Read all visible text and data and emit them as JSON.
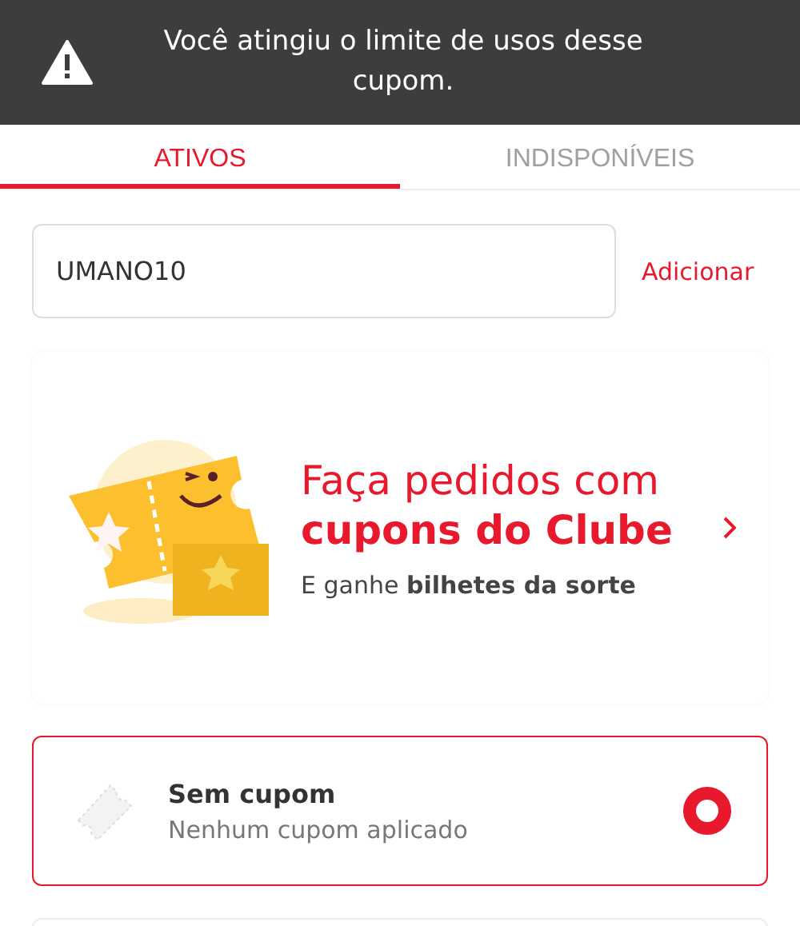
{
  "toast": {
    "message": "Você atingiu o limite de usos desse cupom."
  },
  "tabs": [
    {
      "label": "ATIVOS",
      "selected": true
    },
    {
      "label": "INDISPONÍVEIS",
      "selected": false
    }
  ],
  "coupon_input": {
    "value": "UMANO10",
    "action": "Adicionar"
  },
  "banner": {
    "title_line_1": "Faça pedidos com",
    "title_line_2": "cupons do Clube",
    "subtitle": "E ganhe **bilhetes da sorte**"
  },
  "options": [
    {
      "title": "Sem cupom",
      "subtitle": "Nenhum cupom aplicado",
      "selected": true
    }
  ]
}
